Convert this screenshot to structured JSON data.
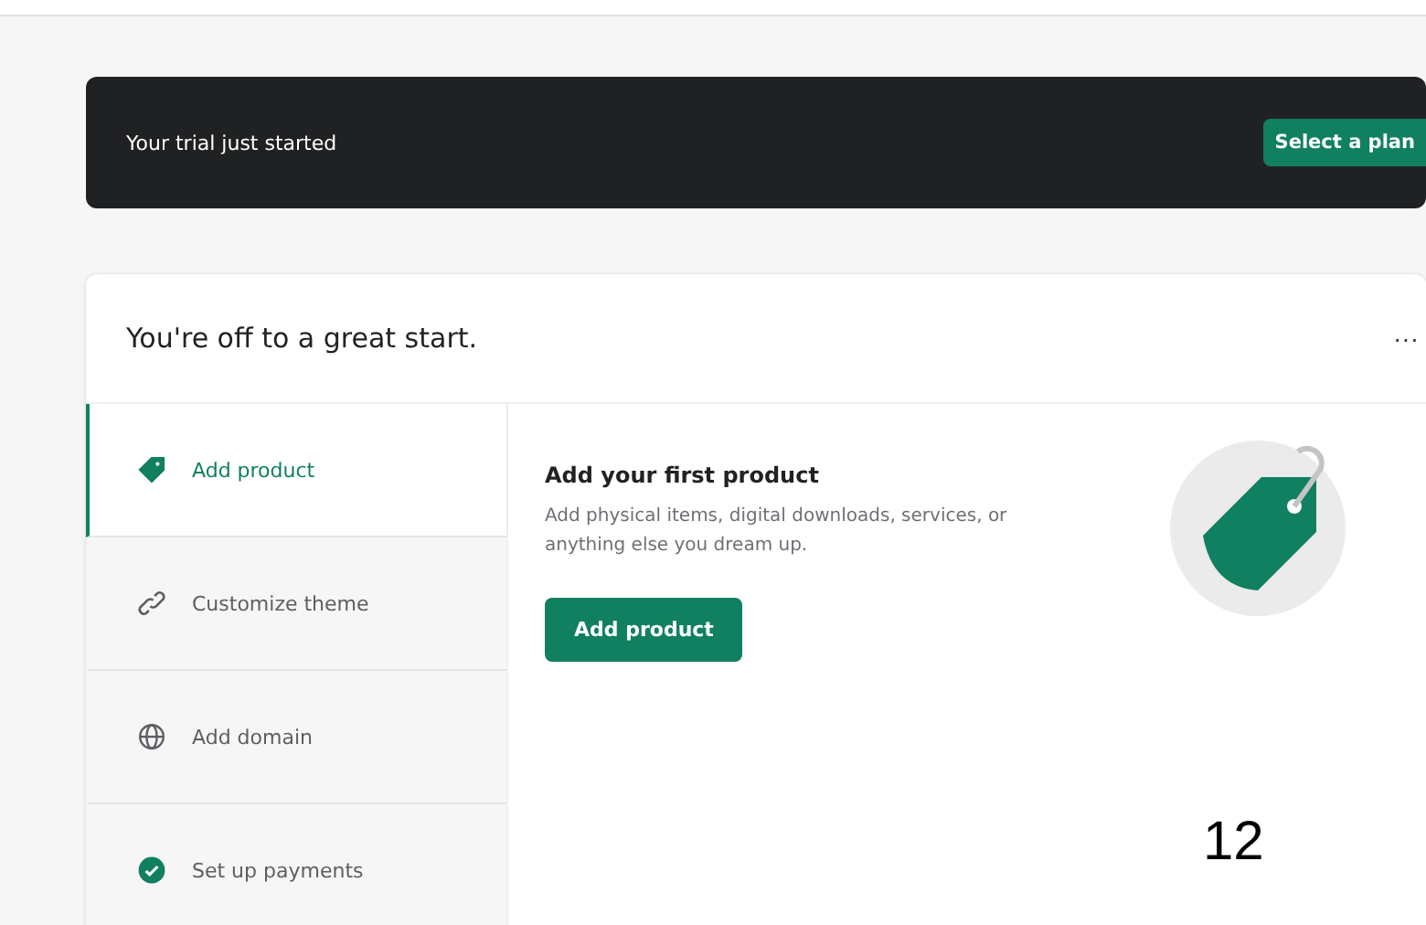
{
  "banner": {
    "text": "Your trial just started",
    "button": "Select a plan"
  },
  "card": {
    "title": "You're off to a great start.",
    "more": "···",
    "steps": [
      {
        "label": "Add product",
        "kind": "tag",
        "selected": true
      },
      {
        "label": "Customize theme",
        "kind": "link",
        "selected": false
      },
      {
        "label": "Add domain",
        "kind": "globe",
        "selected": false
      },
      {
        "label": "Set up payments",
        "kind": "done",
        "selected": false
      }
    ],
    "detail": {
      "title": "Add your first product",
      "description": "Add physical items, digital downloads, services, or anything else you dream up.",
      "button": "Add product"
    }
  },
  "page_number": "12"
}
